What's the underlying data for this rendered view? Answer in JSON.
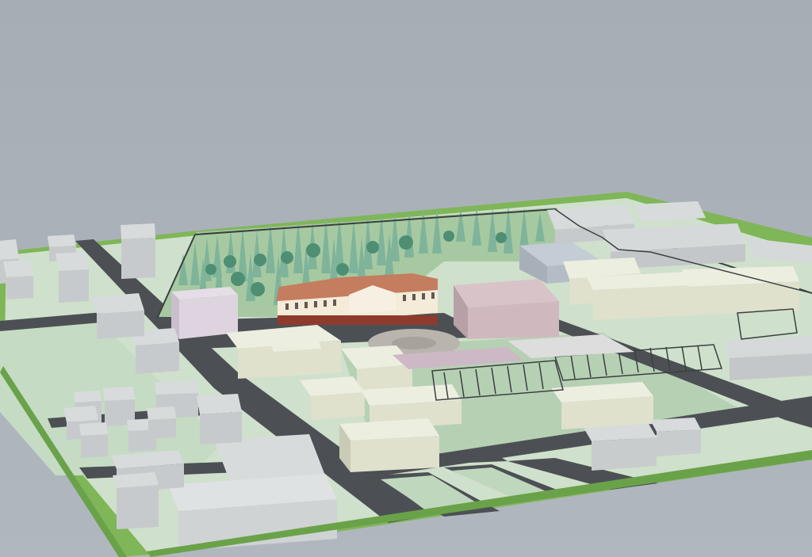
{
  "scene": {
    "kind": "3d-urban-block-render",
    "colors": {
      "sky": "#a9b0b7",
      "grass": "#7fb657",
      "lawn": "#c9dcc7",
      "road": "#4a4e52",
      "block_top": "#eceee0",
      "block_front": "#dfe1cd",
      "block_side": "#c9cbb6",
      "grey_top": "#d8dbdc",
      "lilac_top": "#e6dde8",
      "pink_top": "#d8c4c8",
      "tree": "#7fb49b",
      "tree_dark": "#4e8f74",
      "manor_wall": "#f4ebd8",
      "manor_roof": "#c47d5e",
      "fence": "#3a4040"
    }
  }
}
